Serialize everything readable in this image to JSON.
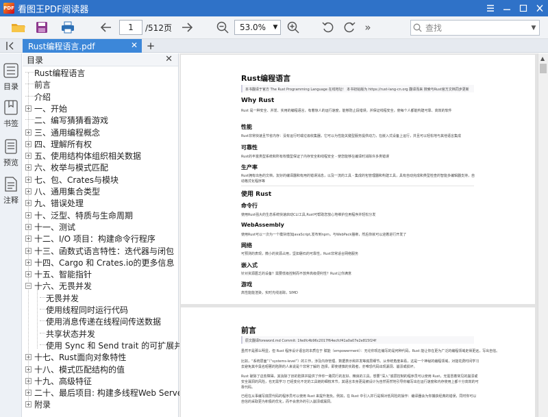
{
  "window": {
    "title": "看图王PDF阅读器",
    "logo_text": "PDF",
    "colors": {
      "titlebar": "#2f72c8",
      "tab_active": "#3c87d9"
    }
  },
  "toolbar": {
    "page_current": "1",
    "page_total": "/512页",
    "zoom": "53.0%",
    "search_placeholder": "查找",
    "more_glyph": "»"
  },
  "tabs": [
    {
      "label": "Rust编程语言.pdf"
    }
  ],
  "sidebar": {
    "items": [
      {
        "label": "目录",
        "icon": "list-icon"
      },
      {
        "label": "书签",
        "icon": "bookmark-icon"
      },
      {
        "label": "预览",
        "icon": "preview-icon"
      },
      {
        "label": "注释",
        "icon": "annotation-icon"
      }
    ]
  },
  "toc": {
    "header": "目录",
    "items": [
      {
        "label": "Rust编程语言",
        "level": 0,
        "expander": ""
      },
      {
        "label": "前言",
        "level": 0,
        "expander": ""
      },
      {
        "label": "介绍",
        "level": 0,
        "expander": ""
      },
      {
        "label": "一、开始",
        "level": 0,
        "expander": "+"
      },
      {
        "label": "二、编写猜猜看游戏",
        "level": 0,
        "expander": ""
      },
      {
        "label": "三、通用编程概念",
        "level": 0,
        "expander": "+"
      },
      {
        "label": "四、理解所有权",
        "level": 0,
        "expander": "+"
      },
      {
        "label": "五、使用结构体组织相关数据",
        "level": 0,
        "expander": "+"
      },
      {
        "label": "六、枚举与模式匹配",
        "level": 0,
        "expander": "+"
      },
      {
        "label": "七、包、Crates与模块",
        "level": 0,
        "expander": "+"
      },
      {
        "label": "八、通用集合类型",
        "level": 0,
        "expander": "+"
      },
      {
        "label": "九、错误处理",
        "level": 0,
        "expander": "+"
      },
      {
        "label": "十、泛型、特质与生命周期",
        "level": 0,
        "expander": "+"
      },
      {
        "label": "十一、测试",
        "level": 0,
        "expander": "+"
      },
      {
        "label": "十二、I/O 项目：构建命令行程序",
        "level": 0,
        "expander": "+"
      },
      {
        "label": "十三、函数式语言特性：迭代器与闭包",
        "level": 0,
        "expander": "+"
      },
      {
        "label": "十四、Cargo 和 Crates.io的更多信息",
        "level": 0,
        "expander": "+"
      },
      {
        "label": "十五、智能指针",
        "level": 0,
        "expander": "+"
      },
      {
        "label": "十六、无畏并发",
        "level": 0,
        "expander": "−"
      },
      {
        "label": "无畏并发",
        "level": 1,
        "expander": ""
      },
      {
        "label": "使用线程同时运行代码",
        "level": 1,
        "expander": ""
      },
      {
        "label": "使用消息传递在线程间传送数据",
        "level": 1,
        "expander": ""
      },
      {
        "label": "共享状态并发",
        "level": 1,
        "expander": ""
      },
      {
        "label": "使用 Sync 和 Send trait 的可扩展并发",
        "level": 1,
        "expander": ""
      },
      {
        "label": "十七、Rust面向对象特性",
        "level": 0,
        "expander": "+"
      },
      {
        "label": "十八、模式匹配结构的值",
        "level": 0,
        "expander": "+"
      },
      {
        "label": "十九、高级特征",
        "level": 0,
        "expander": "+"
      },
      {
        "label": "二十、最后项目: 构建多线程Web Server",
        "level": 0,
        "expander": "+"
      },
      {
        "label": "附录",
        "level": 0,
        "expander": "+"
      }
    ]
  },
  "document": {
    "page1": {
      "title": "Rust编程语言",
      "note": "本书翻译于官方 The Rust Programming Language 在线地址！ 本书初始版为 https://rust-lang-cn.org 翻译而来 搜索与Rust官方文档同步更新",
      "h_why": "Why Rust",
      "why_text": "Rust 是一种安全、并发、实用的编程语言，有着惊人的运行速度，能够防止段错误，并保证线程安全，使每个人都能构建可靠、高效的软件",
      "h_perf": "性能",
      "perf_text": "Rust非常快速且节省内存：没有运行时或垃圾收集器，它可以为性能关键型服务提供动力，在嵌入式设备上运行，并且可以轻松地与其他语言集成",
      "h_rel": "可靠性",
      "rel_text": "Rust的丰富类型系统和所有权模型保证了内存安全和线程安全 - 使您能够在编译时消除许多类错误",
      "h_prod": "生产率",
      "prod_text1": "Rust拥有出色的文档，友好的编译器和有用的错误消息，以及一流的工具 - 集成的包管理器和构建工具，具有自动完成和类型检查的智能多编辑器支持，自",
      "prod_text2": "动格式化程序等",
      "h_use": "使用 Rust",
      "h_cli": "命令行",
      "cli_text": "使用Rust强大的生态系统快速启动CLI工具,Rust可帮助您放心地维护应用程序并轻松分发",
      "h_wasm": "WebAssembly",
      "wasm_text": "使用Rust可以一次为一个模块增加JavaScript,发布到npm，与WebPack捆绑，然后你就可以迎着进行开发了",
      "h_net": "网络",
      "net_text": "可预测的表现，微小的资源占用，坚如磐石的可靠性，Rust非常适合网络服务",
      "h_emb": "嵌入式",
      "emb_text": "针对资源匮乏的设备？需要低级控制而不放弃高级便利性？Rust让你满意",
      "h_game": "游戏",
      "game_text": "高性能能渲染，实时光线追踪，SIMD"
    },
    "page2": {
      "title": "前言",
      "note": "原文翻译foreword.md    Commit: 1fedfc4b96c2017f64ecfcf41a0a07e2e815f24f",
      "lines": [
        "虽然不是那么明显，但 Rust 程序设计语言的本质在于 赋能（empowerment）：无论你现在编写的是何种代码，Rust 能让你在更为广泛的编程领域走得更远，写出自信。",
        "比如，“系统层面”（“systems-level”）的工作，涉及内存管理、数据表示和并发等底层细节。从传统角度来看，这是一个神秘的编程领域，对能花费时间学习",
        "去避免其中臭名昭著的陷阱的人来说是个非常了解的 选择，即使谨慎的实践者，亦唯恐代码出现漏洞、崩溃或损坏。",
        "Rust 破除了这些障碍，其消除了旧的陷阱并提供了伴你一路同行的友好、精良的工具。想要“深入”底层控制的程序员可以使用 Rust，无需冒着常见的崩溃或",
        "安全漏洞的风险，也无需学习 已经变化不定的工具链的细枝末节。其语言本身更是被设计为自然而然地引导你编写出在运行速度和内存使用上都十分高效的可",
        "靠代码。",
        "已经在从事编写底层代码的程序员可以使用 Rust 来提升抱负。例如，在 Rust 中引入并行是相对低风险的操作：编译器会为你捕获经典的错误，同时你可以",
        "自信的采取更为积极的优化，而不会意外的引入崩溃或漏洞。"
      ]
    }
  }
}
